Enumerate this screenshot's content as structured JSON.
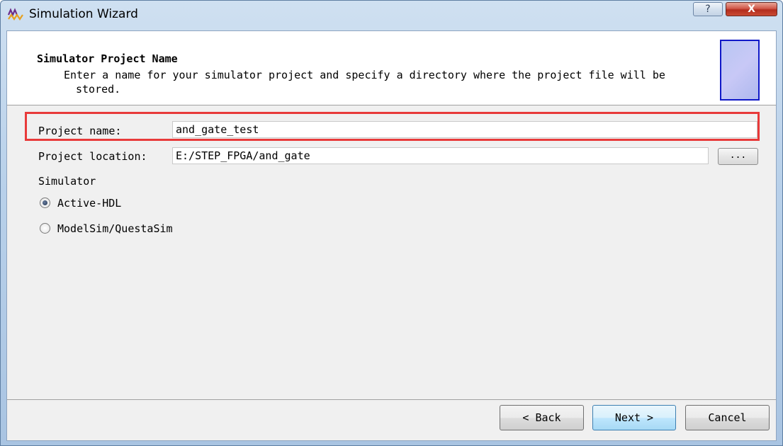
{
  "window": {
    "title": "Simulation Wizard",
    "help_glyph": "?",
    "close_glyph": "X"
  },
  "header": {
    "title": "Simulator Project Name",
    "description": "Enter a name for your simulator project and specify a directory where the project file will be stored."
  },
  "form": {
    "project_name_label": "Project name:",
    "project_name_value": "and_gate_test",
    "project_location_label": "Project location:",
    "project_location_value": "E:/STEP_FPGA/and_gate",
    "browse_label": "...",
    "simulator_label": "Simulator",
    "simulators": [
      {
        "label": "Active-HDL",
        "selected": true
      },
      {
        "label": "ModelSim/QuestaSim",
        "selected": false
      }
    ]
  },
  "buttons": {
    "back": "< Back",
    "next": "Next >",
    "cancel": "Cancel"
  },
  "colors": {
    "highlight": "#e83a3a",
    "logo_border": "#1018c8"
  },
  "icons": {
    "app": "waveform-icon",
    "help": "help-icon",
    "close": "close-icon"
  }
}
